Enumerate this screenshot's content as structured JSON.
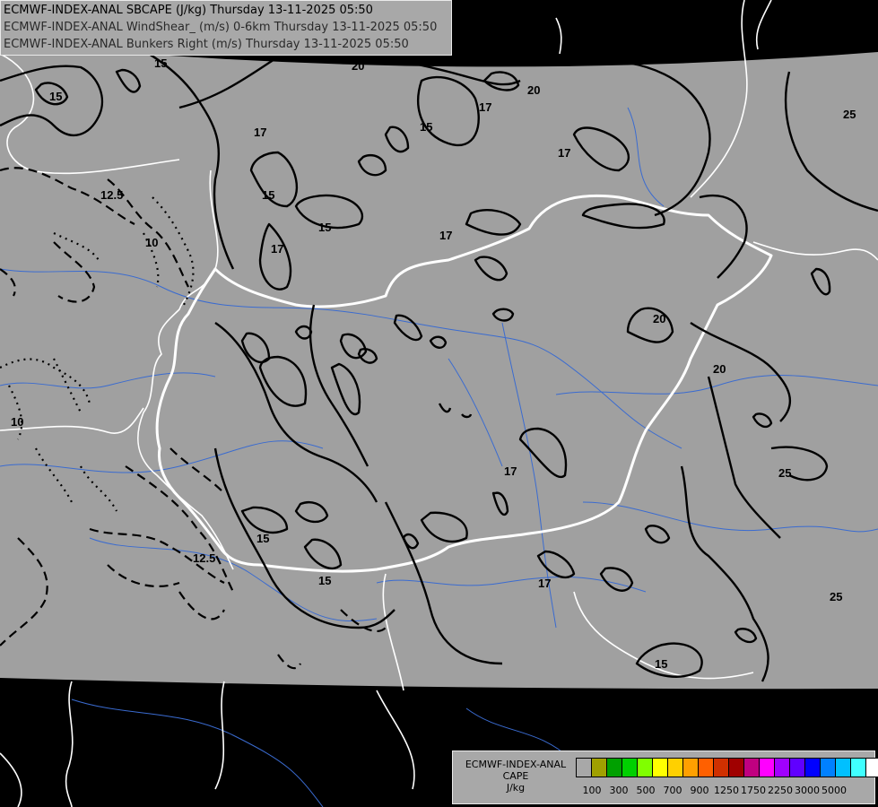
{
  "header": {
    "line1": "ECMWF-INDEX-ANAL SBCAPE (J/kg) Thursday 13-11-2025 05:50",
    "line2": "ECMWF-INDEX-ANAL WindShear_ (m/s) 0-6km Thursday 13-11-2025 05:50",
    "line3": "ECMWF-INDEX-ANAL Bunkers Right (m/s) Thursday 13-11-2025 05:50"
  },
  "legend": {
    "source": "ECMWF-INDEX-ANAL",
    "variable": "CAPE",
    "unit": "J/kg",
    "colors": [
      "#a8a8a8",
      "#a0a000",
      "#00a000",
      "#00d000",
      "#80ff00",
      "#ffff00",
      "#ffd000",
      "#ffa000",
      "#ff6000",
      "#d03000",
      "#a00000",
      "#c00080",
      "#ff00ff",
      "#a000ff",
      "#6000ff",
      "#0000ff",
      "#0080ff",
      "#00c0ff",
      "#40ffff",
      "#ffffff"
    ],
    "tick_labels": [
      "100",
      "300",
      "500",
      "700",
      "900",
      "1250",
      "1750",
      "2250",
      "3000",
      "5000"
    ]
  },
  "colors": {
    "domain_fill": "#a0a0a0",
    "background": "#000000",
    "border": "#ffffff",
    "river": "#3a6bd0",
    "contour": "#000000"
  },
  "contour_labels": [
    "15",
    "15",
    "15",
    "15",
    "15",
    "15",
    "15",
    "15",
    "12.5",
    "12.5",
    "10",
    "10",
    "17",
    "17",
    "17",
    "17",
    "17",
    "17",
    "17",
    "20",
    "20",
    "20",
    "20",
    "25",
    "25",
    "25"
  ]
}
